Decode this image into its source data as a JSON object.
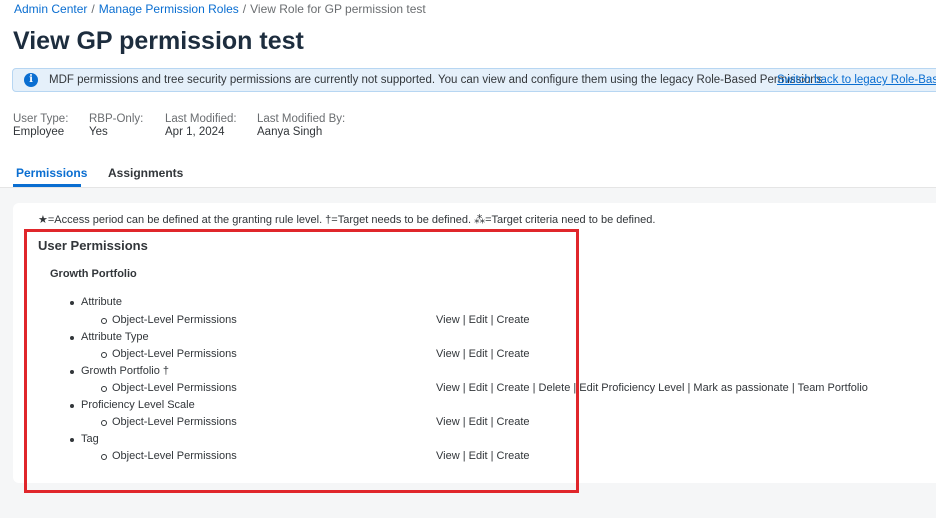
{
  "breadcrumb": {
    "items": [
      "Admin Center",
      "Manage Permission Roles",
      "View Role for GP permission test"
    ],
    "separator": "/"
  },
  "page_title": "View GP permission test",
  "banner": {
    "icon": "info-icon",
    "text": "MDF permissions and tree security permissions are currently not supported. You can view and configure them using the legacy Role-Based Permissions.",
    "link": "Switch back to legacy Role-Based Permissions"
  },
  "meta": [
    {
      "label": "User Type:",
      "value": "Employee"
    },
    {
      "label": "RBP-Only:",
      "value": "Yes"
    },
    {
      "label": "Last Modified:",
      "value": "Apr 1, 2024"
    },
    {
      "label": "Last Modified By:",
      "value": "Aanya Singh"
    }
  ],
  "tabs": [
    {
      "label": "Permissions",
      "active": true
    },
    {
      "label": "Assignments",
      "active": false
    }
  ],
  "legend": "★=Access period can be defined at the granting rule level.  †=Target needs to be defined.  ⁂=Target criteria need to be defined.",
  "section_title": "User Permissions",
  "group_title": "Growth Portfolio",
  "items": [
    {
      "name": "Attribute",
      "sub": "Object-Level Permissions",
      "perms": "View | Edit | Create"
    },
    {
      "name": "Attribute Type",
      "sub": "Object-Level Permissions",
      "perms": "View | Edit | Create"
    },
    {
      "name": "Growth Portfolio †",
      "sub": "Object-Level Permissions",
      "perms": "View | Edit | Create | Delete | Edit Proficiency Level | Mark as passionate | Team Portfolio"
    },
    {
      "name": "Proficiency Level Scale",
      "sub": "Object-Level Permissions",
      "perms": "View | Edit | Create"
    },
    {
      "name": "Tag",
      "sub": "Object-Level Permissions",
      "perms": "View | Edit | Create"
    }
  ],
  "colors": {
    "accent": "#0a6ed1",
    "highlight": "#e0262b",
    "banner_bg": "#e5f0fa"
  }
}
